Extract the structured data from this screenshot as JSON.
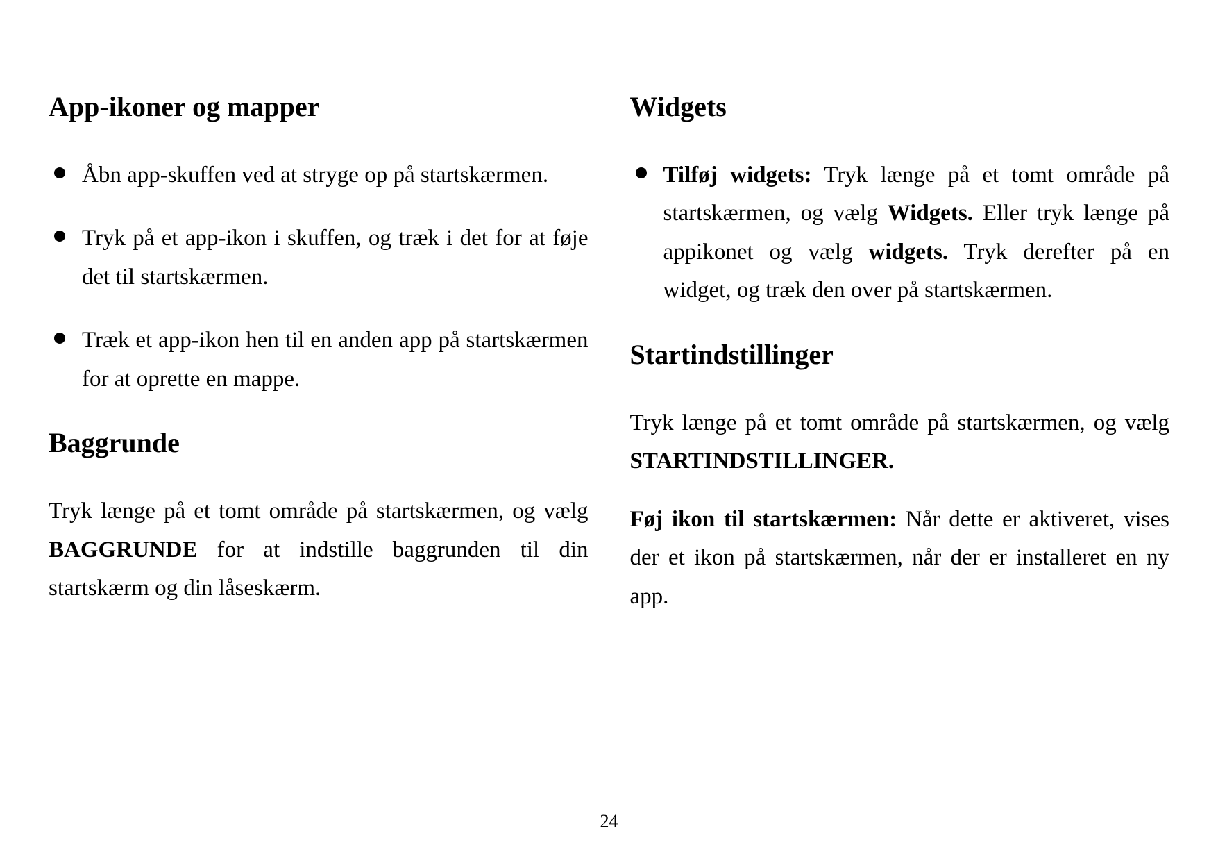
{
  "left": {
    "heading1": "App-ikoner og mapper",
    "bullets": [
      "Åbn app-skuffen ved at stryge op på startskærmen.",
      "Tryk på et app-ikon i skuffen, og træk i det for at føje det til startskærmen.",
      "Træk et app-ikon hen til en anden app på startskærmen for at oprette en mappe."
    ],
    "heading2": "Baggrunde",
    "para2_pre": "Tryk længe på et tomt område på startskærmen, og vælg ",
    "para2_bold": "BAGGRUNDE",
    "para2_post": " for at indstille baggrunden til din startskærm og din låseskærm."
  },
  "right": {
    "heading1": "Widgets",
    "bullet1_a_bold": "Tilføj widgets:",
    "bullet1_b": " Tryk længe på et tomt område på startskærmen, og vælg  ",
    "bullet1_c_bold": "Widgets.",
    "bullet1_d": " Eller tryk længe på appikonet og vælg ",
    "bullet1_e_bold": "widgets.",
    "bullet1_f": " Tryk derefter på en widget, og træk den over på startskærmen.",
    "heading2": "Startindstillinger",
    "para1_pre": "Tryk længe på et tomt område på startskærmen, og vælg ",
    "para1_bold": "STARTINDSTILLINGER.",
    "para2_bold": "Føj ikon til startskærmen:",
    "para2_post": " Når dette er aktiveret, vises der et ikon på startskærmen, når der er installeret en ny app."
  },
  "page_number": "24"
}
